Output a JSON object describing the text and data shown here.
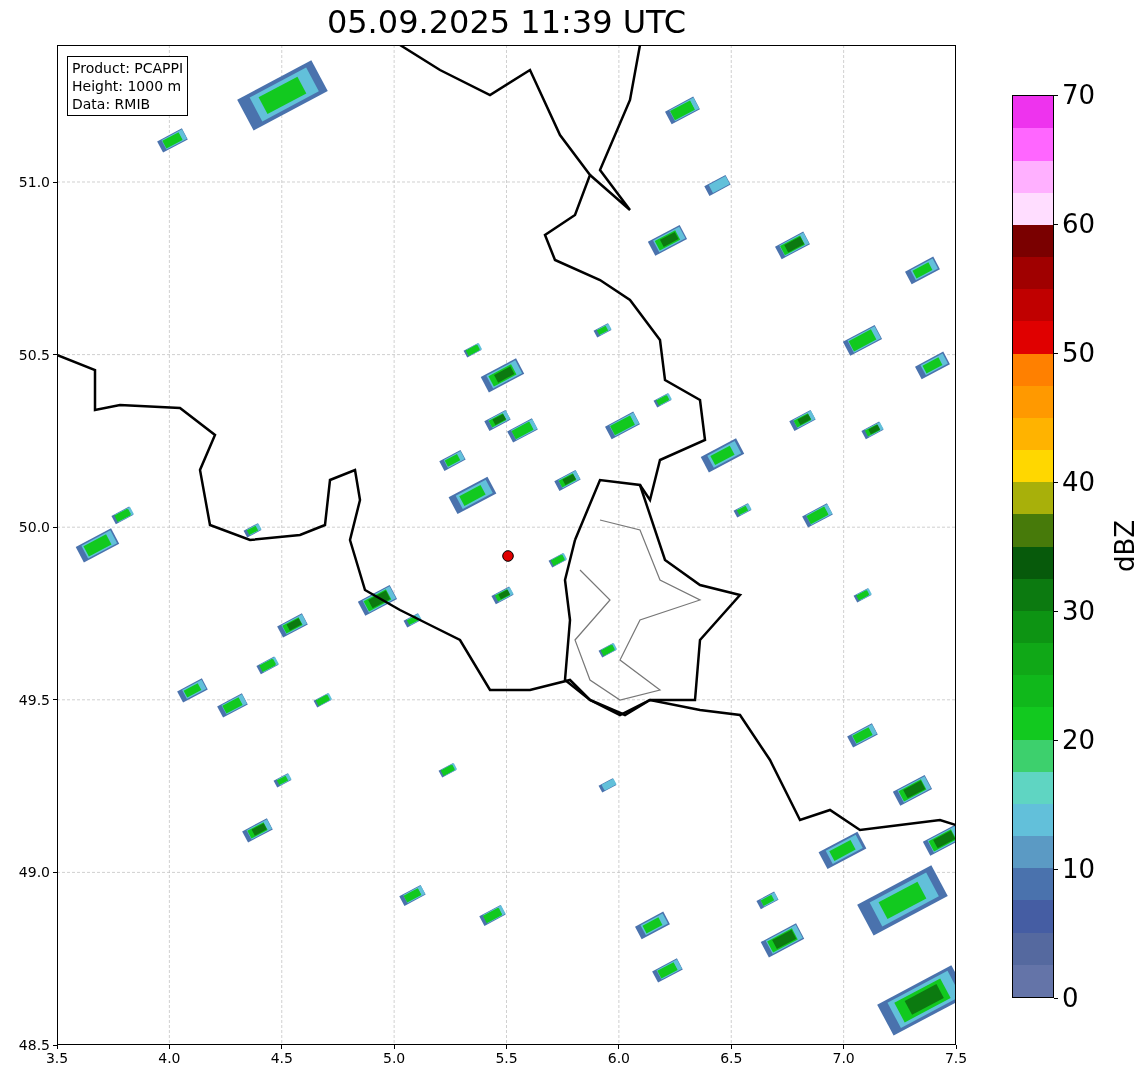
{
  "title": "05.09.2025 11:39 UTC",
  "info_box": {
    "lines": [
      "Product: PCAPPI",
      "Height: 1000 m",
      "Data: RMIB"
    ]
  },
  "x_axis": {
    "ticks": [
      "3.5",
      "4.0",
      "4.5",
      "5.0",
      "5.5",
      "6.0",
      "6.5",
      "7.0",
      "7.5"
    ]
  },
  "y_axis": {
    "ticks": [
      "51.0",
      "50.5",
      "50.0",
      "49.5",
      "49.0",
      "48.5"
    ]
  },
  "colorbar": {
    "label": "dBZ",
    "ticks": [
      "70",
      "60",
      "50",
      "40",
      "30",
      "20",
      "10",
      "0"
    ],
    "bins": [
      {
        "color": "#6474a8"
      },
      {
        "color": "#55699f"
      },
      {
        "color": "#455da3"
      },
      {
        "color": "#4a72ad"
      },
      {
        "color": "#5b9ac4"
      },
      {
        "color": "#62c0da"
      },
      {
        "color": "#5fd5c2"
      },
      {
        "color": "#3dd06d"
      },
      {
        "color": "#12c91f"
      },
      {
        "color": "#10b81b"
      },
      {
        "color": "#10a817"
      },
      {
        "color": "#0d9413"
      },
      {
        "color": "#0c7a10"
      },
      {
        "color": "#075a0b"
      },
      {
        "color": "#477a0a"
      },
      {
        "color": "#a8b00a"
      },
      {
        "color": "#ffd700"
      },
      {
        "color": "#ffb300"
      },
      {
        "color": "#ff9900"
      },
      {
        "color": "#ff8000"
      },
      {
        "color": "#e00000"
      },
      {
        "color": "#c00000"
      },
      {
        "color": "#a00000"
      },
      {
        "color": "#7a0000"
      },
      {
        "color": "#ffddff"
      },
      {
        "color": "#ffb0ff"
      },
      {
        "color": "#ff66ff"
      },
      {
        "color": "#ee33ee"
      }
    ]
  }
}
